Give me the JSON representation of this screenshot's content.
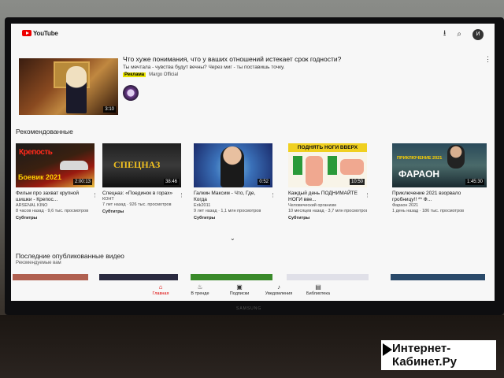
{
  "header": {
    "logo_text": "YouTube",
    "upload_icon": "upload-icon",
    "search_icon": "search-icon",
    "avatar_letter": "И"
  },
  "featured": {
    "title": "Что хуже понимания, что у вашиx отношений истекает срок годности?",
    "description": "Ты мечтала - чувства будут вечны? Через миг - ты поставишь точку.",
    "ad_label": "Реклама",
    "channel": "Margo Official",
    "duration": "3:10"
  },
  "sections": {
    "recommended": "Рекомендованные",
    "latest": "Последние опубликованные видео",
    "latest_sub": "Рекомендуемые вам"
  },
  "videos": [
    {
      "title": "Фильм про захват крупной шишки - Крепос...",
      "channel": "ARSENAL KINO",
      "meta": "8 часов назад · 9,6 тыс. просмотров",
      "subs": "Субтитры",
      "duration": "2:00:13",
      "thumb_text": "Боевик 2021",
      "thumb_text2": "Крепость"
    },
    {
      "title": "Спецназ: «Поединок в горах»",
      "channel": "КОНТ",
      "meta": "7 лет назад · 926 тыс. просмотров",
      "subs": "Субтитры",
      "duration": "38:46",
      "thumb_text": "СПЕЦНАЗ"
    },
    {
      "title": "Галкин Максим - Что, Где, Когда",
      "channel": "Erik2011",
      "meta": "9 лет назад · 1,1 млн просмотров",
      "subs": "Субтитры",
      "duration": "0:52"
    },
    {
      "title": "Каждый день ПОДНИМАЙТЕ НОГИ вве...",
      "channel": "Человеческий организм",
      "meta": "10 месяцев назад · 3,7 млн просмотров",
      "subs": "Субтитры",
      "duration": "10:50",
      "thumb_text": "ПОДНЯТЬ НОГИ ВВЕРХ"
    },
    {
      "title": "Приключение 2021 взорвало гробницу!! ** Ф...",
      "channel": "Фараон 2021",
      "meta": "1 день назад · 186 тыс. просмотров",
      "subs": "",
      "duration": "1:45:30",
      "thumb_text": "ФАРАОН",
      "thumb_text2": "ПРИКЛЮЧЕНИЕ 2021"
    }
  ],
  "nav": [
    {
      "label": "Главная",
      "icon": "home-icon"
    },
    {
      "label": "В тренде",
      "icon": "trending-icon"
    },
    {
      "label": "Подписки",
      "icon": "subscriptions-icon"
    },
    {
      "label": "Уведомления",
      "icon": "bell-icon"
    },
    {
      "label": "Библиотека",
      "icon": "library-icon"
    }
  ],
  "tv_brand": "SAMSUNG",
  "watermark": {
    "line1": "Интернет-",
    "line2": "Кабинет.Ру"
  }
}
